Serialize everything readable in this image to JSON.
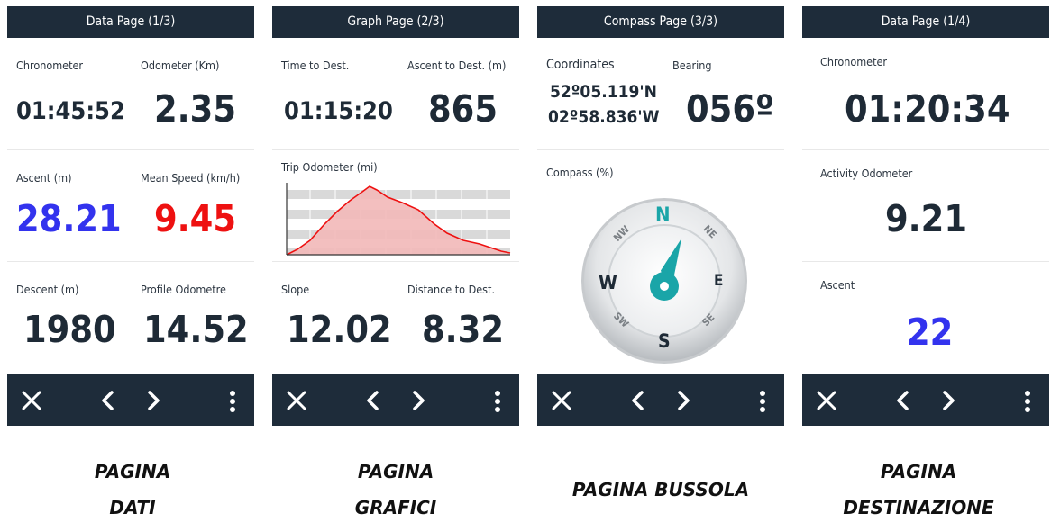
{
  "screens": [
    {
      "header": "Data Page (1/3)",
      "fields": [
        {
          "label": "Chronometer",
          "value": "01:45:52",
          "color": "#1e2a36"
        },
        {
          "label": "Odometer (Km)",
          "value": "2.35",
          "color": "#1e2a36"
        },
        {
          "label": "Ascent (m)",
          "value": "28.21",
          "color": "#3333ee"
        },
        {
          "label": "Mean Speed (km/h)",
          "value": "9.45",
          "color": "#ee1111"
        },
        {
          "label": "Descent (m)",
          "value": "1980",
          "color": "#1e2a36"
        },
        {
          "label": "Profile Odometre",
          "value": "14.52",
          "color": "#1e2a36"
        }
      ]
    },
    {
      "header": "Graph Page (2/3)",
      "fields": [
        {
          "label": "Time to Dest.",
          "value": "01:15:20"
        },
        {
          "label": "Ascent to Dest. (m)",
          "value": "865"
        },
        {
          "label": "Slope",
          "value": "12.02"
        },
        {
          "label": "Distance to Dest.",
          "value": "8.32"
        }
      ],
      "graph": {
        "label": "Trip Odometer (mi)",
        "type": "area",
        "line_color": "#ee1111",
        "fill_color": "#f2b8b8"
      }
    },
    {
      "header": "Compass Page (3/3)",
      "coordinates_label": "Coordinates",
      "latitude": "52º05.119'N",
      "longitude": "02º58.836'W",
      "bearing_label": "Bearing",
      "bearing": "056º",
      "compass_label": "Compass (%)",
      "compass_letters": {
        "N": "N",
        "NE": "NE",
        "E": "E",
        "SE": "SE",
        "S": "S",
        "SW": "SW",
        "W": "W",
        "NW": "NW"
      },
      "needle_color": "#1aa5a8"
    },
    {
      "header": "Data Page (1/4)",
      "fields": [
        {
          "label": "Chronometer",
          "value": "01:20:34",
          "color": "#1e2a36"
        },
        {
          "label": "Activity Odometer",
          "value": "9.21",
          "color": "#1e2a36"
        },
        {
          "label": "Ascent",
          "value": "22",
          "color": "#3333ee"
        }
      ]
    }
  ],
  "footer_buttons": [
    "close-icon",
    "chevron-left-icon",
    "chevron-right-icon",
    "more-vertical-icon"
  ],
  "captions": [
    [
      "PAGINA",
      "DATI"
    ],
    [
      "PAGINA",
      "GRAFICI"
    ],
    [
      "PAGINA BUSSOLA"
    ],
    [
      "PAGINA",
      "DESTINAZIONE"
    ]
  ]
}
